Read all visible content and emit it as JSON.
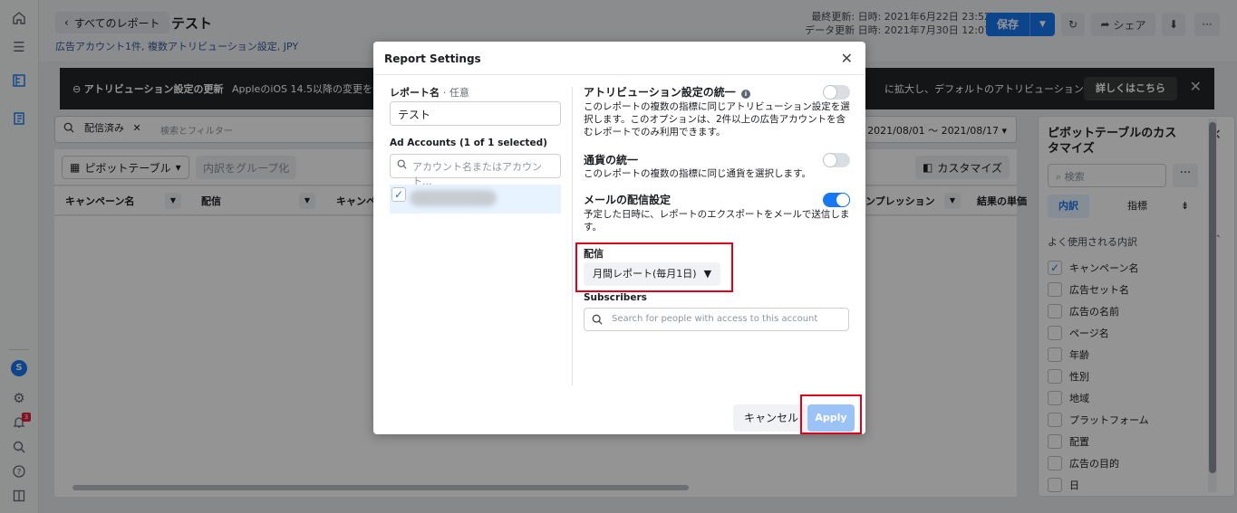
{
  "header": {
    "back_label": "すべてのレポート",
    "title": "テスト",
    "subtitle": "広告アカウント1件, 複数アトリビューション設定, JPY",
    "last_modified": "最終更新: 日時: 2021年6月22日 23:52",
    "data_updated": "データ更新 日時: 2021年7月30日 12:07",
    "save_label": "保存",
    "share_label": "シェア"
  },
  "banner": {
    "title": "アトリビューション設定の更新",
    "text": "AppleのiOS 14.5以降の変更を受け",
    "text2": "に拡大し、デフォルトのアトリビューション...",
    "more_label": "詳しくはこちら"
  },
  "filter": {
    "chip": "配信済み",
    "placeholder": "検索とフィルター",
    "date_range": "月: 2021/08/01 ～ 2021/08/17"
  },
  "toolbar": {
    "pivot_label": "ピボットテーブル",
    "group_label": "内訳をグループ化",
    "customize_label": "カスタマイズ"
  },
  "columns": [
    "キャンペーン名",
    "配信",
    "キャンペ",
    "ンプレッション",
    "結果の単価"
  ],
  "right_panel": {
    "title": "ピボットテーブルのカスタマイズ",
    "search_placeholder": "検索",
    "tab_breakdown": "内訳",
    "tab_metrics": "指標",
    "section": "よく使用される内訳",
    "items": [
      {
        "label": "キャンペーン名",
        "checked": true
      },
      {
        "label": "広告セット名",
        "checked": false
      },
      {
        "label": "広告の名前",
        "checked": false
      },
      {
        "label": "ページ名",
        "checked": false
      },
      {
        "label": "年齢",
        "checked": false
      },
      {
        "label": "性別",
        "checked": false
      },
      {
        "label": "地域",
        "checked": false
      },
      {
        "label": "プラットフォーム",
        "checked": false
      },
      {
        "label": "配置",
        "checked": false
      },
      {
        "label": "広告の目的",
        "checked": false
      },
      {
        "label": "日",
        "checked": false
      }
    ]
  },
  "nav": {
    "avatar_letter": "S",
    "notification_count": "3"
  },
  "modal": {
    "title": "Report Settings",
    "report_name_label": "レポート名",
    "optional": "· 任意",
    "report_name_value": "テスト",
    "ad_accounts_label": "Ad Accounts (1 of 1 selected)",
    "account_search_placeholder": "アカウント名またはアカウント...",
    "attribution_title": "アトリビューション設定の統一",
    "attribution_desc": "このレポートの複数の指標に同じアトリビューション設定を選択します。このオプションは、2件以上の広告アカウントを含むレポートでのみ利用できます。",
    "currency_title": "通貨の統一",
    "currency_desc": "このレポートの複数の指標に同じ通貨を選択します。",
    "email_title": "メールの配信設定",
    "email_desc": "予定した日時に、レポートのエクスポートをメールで送信します。",
    "schedule_label": "配信",
    "schedule_value": "月間レポート(毎月1日)",
    "subscribers_label": "Subscribers",
    "subscribers_placeholder": "Search for people with access to this account",
    "cancel_label": "キャンセル",
    "apply_label": "Apply",
    "attribution_enabled": false,
    "currency_enabled": false,
    "email_enabled": true
  },
  "colors": {
    "accent": "#1877f2",
    "highlight": "#e0001a"
  }
}
